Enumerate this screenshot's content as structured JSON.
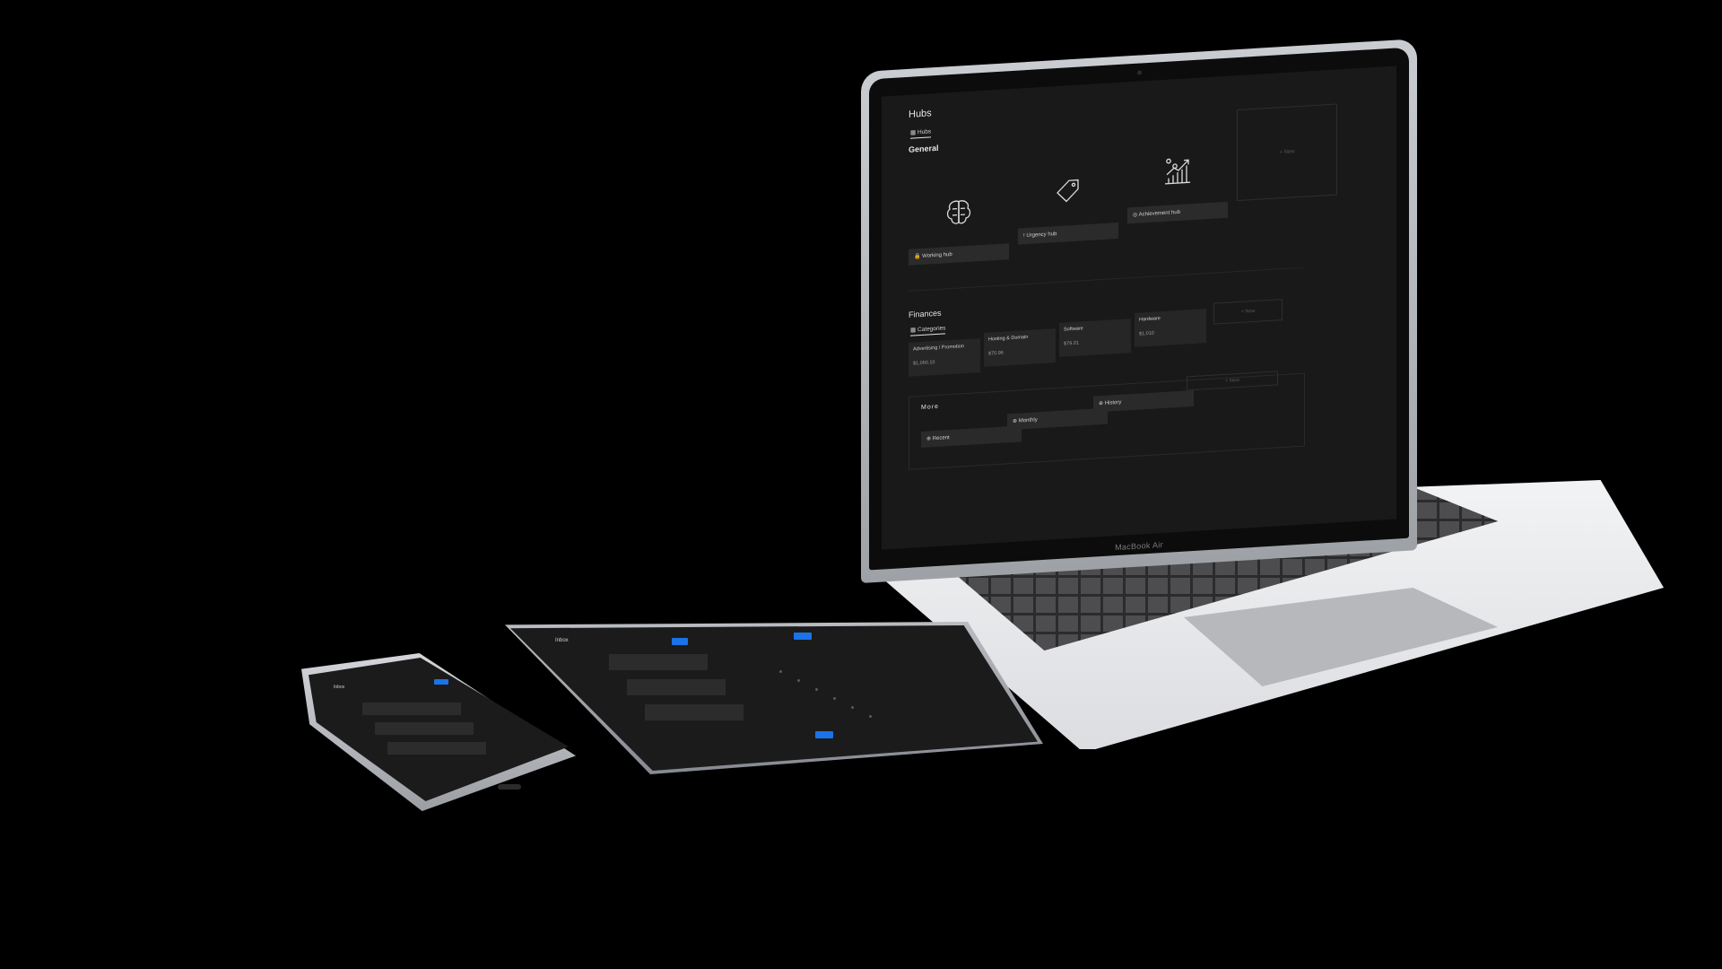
{
  "laptop": {
    "brand": "MacBook Air",
    "hubs_title": "Hubs",
    "hubs_tab": "Hubs",
    "general_title": "General",
    "hub_cards": [
      {
        "label": "Working hub",
        "icon": "brain-icon"
      },
      {
        "label": "Urgency hub",
        "icon": "tag-icon"
      },
      {
        "label": "Achievement hub",
        "icon": "growth-chart-icon"
      }
    ],
    "new_label": "+ New",
    "finances_title": "Finances",
    "finances_tab": "Categories",
    "finance_cards": [
      {
        "label": "Advertising / Promotion",
        "amount": "$1,060.10"
      },
      {
        "label": "Hosting & Domain",
        "amount": "$70.96"
      },
      {
        "label": "Software",
        "amount": "$79.01"
      },
      {
        "label": "Hardware",
        "amount": "$1,010"
      }
    ],
    "more_title": "More",
    "more_items": [
      "Recent",
      "Monthly",
      "History"
    ]
  },
  "tablet": {
    "title": "Inbox"
  },
  "phone": {
    "title": "Inbox"
  },
  "colors": {
    "background": "#000000",
    "screen": "#191919",
    "card": "#2b2b2b",
    "accent_blue": "#1a73e8",
    "body_silver": "#dcdde0"
  }
}
